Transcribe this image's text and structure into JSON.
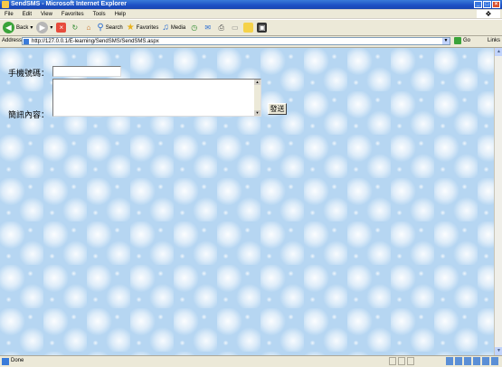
{
  "window": {
    "title": "SendSMS - Microsoft Internet Explorer"
  },
  "menu": [
    "File",
    "Edit",
    "View",
    "Favorites",
    "Tools",
    "Help"
  ],
  "toolbar": {
    "back": "Back",
    "search": "Search",
    "favorites": "Favorites",
    "media": "Media"
  },
  "address": {
    "label": "Address",
    "url": "http://127.0.0.1/E-learning/SendSMS/SendSMS.aspx",
    "go": "Go",
    "links": "Links"
  },
  "form": {
    "phone_label": "手機號碼：",
    "phone_value": "",
    "message_label": "簡訊內容：",
    "message_value": "",
    "send_label": "發送"
  },
  "status": {
    "text": "Done"
  },
  "colors": {
    "page_bg": "#b6d6f2",
    "titlebar": "#1d4fc4",
    "chrome": "#ece9d8"
  }
}
